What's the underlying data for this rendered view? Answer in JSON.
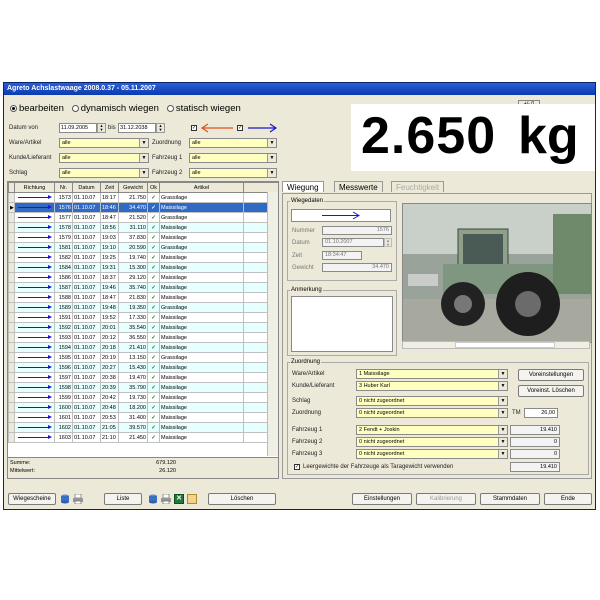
{
  "window": {
    "title": "Agreto Achslastwaage 2008.0.37 - 05.11.2007"
  },
  "modes": [
    {
      "label": "bearbeiten",
      "selected": true
    },
    {
      "label": "dynamisch wiegen",
      "selected": false
    },
    {
      "label": "statisch wiegen",
      "selected": false
    }
  ],
  "filters": {
    "datum_label": "Datum von",
    "date_from": "11.09.2005",
    "bis_label": "bis",
    "date_to": "31.12.2038",
    "ware_label": "Ware/Artikel",
    "ware_value": "alle",
    "zuordnung_label": "Zuordnung",
    "zuordnung_value": "alle",
    "kunde_label": "Kunde/Lieferant",
    "kunde_value": "alle",
    "fahrzeug1_label": "Fahrzeug 1",
    "fahrzeug1_value": "alle",
    "schlag_label": "Schlag",
    "schlag_value": "alle",
    "fahrzeug2_label": "Fahrzeug 2",
    "fahrzeug2_value": "alle"
  },
  "weight": {
    "value": "2.650",
    "unit": "kg",
    "unit_button": "+/- 0"
  },
  "table": {
    "headers": [
      "Richtung",
      "Nr.",
      "Datum",
      "Zeit",
      "Gewicht",
      "Ok",
      "Artikel"
    ],
    "rows": [
      {
        "nr": "1573",
        "datum": "01.10.07",
        "zeit": "18:17",
        "gewicht": "21.750",
        "artikel": "Grassilage"
      },
      {
        "nr": "1576",
        "datum": "01.10.07",
        "zeit": "18:46",
        "gewicht": "34.470",
        "artikel": "Maissilage"
      },
      {
        "nr": "1577",
        "datum": "01.10.07",
        "zeit": "18:47",
        "gewicht": "21.520",
        "artikel": "Grassilage"
      },
      {
        "nr": "1578",
        "datum": "01.10.07",
        "zeit": "18:56",
        "gewicht": "31.110",
        "artikel": "Maissilage"
      },
      {
        "nr": "1579",
        "datum": "01.10.07",
        "zeit": "19:03",
        "gewicht": "37.830",
        "artikel": "Maissilage"
      },
      {
        "nr": "1581",
        "datum": "01.10.07",
        "zeit": "19:10",
        "gewicht": "20.590",
        "artikel": "Grassilage"
      },
      {
        "nr": "1582",
        "datum": "01.10.07",
        "zeit": "19:25",
        "gewicht": "19.740",
        "artikel": "Maissilage"
      },
      {
        "nr": "1584",
        "datum": "01.10.07",
        "zeit": "19:31",
        "gewicht": "15.300",
        "artikel": "Maissilage"
      },
      {
        "nr": "1586",
        "datum": "01.10.07",
        "zeit": "18:37",
        "gewicht": "29.120",
        "artikel": "Maissilage"
      },
      {
        "nr": "1587",
        "datum": "01.10.07",
        "zeit": "19:46",
        "gewicht": "35.740",
        "artikel": "Maissilage"
      },
      {
        "nr": "1588",
        "datum": "01.10.07",
        "zeit": "18:47",
        "gewicht": "21.830",
        "artikel": "Maissilage"
      },
      {
        "nr": "1589",
        "datum": "01.10.07",
        "zeit": "19:48",
        "gewicht": "19.350",
        "artikel": "Grassilage"
      },
      {
        "nr": "1591",
        "datum": "01.10.07",
        "zeit": "19:52",
        "gewicht": "17.330",
        "artikel": "Maissilage"
      },
      {
        "nr": "1592",
        "datum": "01.10.07",
        "zeit": "20:01",
        "gewicht": "35.540",
        "artikel": "Maissilage"
      },
      {
        "nr": "1593",
        "datum": "01.10.07",
        "zeit": "20:12",
        "gewicht": "36.550",
        "artikel": "Maissilage"
      },
      {
        "nr": "1594",
        "datum": "01.10.07",
        "zeit": "20:18",
        "gewicht": "21.410",
        "artikel": "Maissilage"
      },
      {
        "nr": "1595",
        "datum": "01.10.07",
        "zeit": "20:19",
        "gewicht": "13.150",
        "artikel": "Grassilage"
      },
      {
        "nr": "1596",
        "datum": "01.10.07",
        "zeit": "20:27",
        "gewicht": "15.430",
        "artikel": "Maissilage"
      },
      {
        "nr": "1597",
        "datum": "01.10.07",
        "zeit": "20:38",
        "gewicht": "19.470",
        "artikel": "Maissilage"
      },
      {
        "nr": "1598",
        "datum": "01.10.07",
        "zeit": "20:39",
        "gewicht": "35.790",
        "artikel": "Maissilage"
      },
      {
        "nr": "1599",
        "datum": "01.10.07",
        "zeit": "20:42",
        "gewicht": "19.730",
        "artikel": "Maissilage"
      },
      {
        "nr": "1600",
        "datum": "01.10.07",
        "zeit": "20:48",
        "gewicht": "18.200",
        "artikel": "Maissilage"
      },
      {
        "nr": "1601",
        "datum": "01.10.07",
        "zeit": "20:53",
        "gewicht": "31.400",
        "artikel": "Maissilage"
      },
      {
        "nr": "1602",
        "datum": "01.10.07",
        "zeit": "21:05",
        "gewicht": "39.570",
        "artikel": "Maissilage"
      },
      {
        "nr": "1603",
        "datum": "01.10.07",
        "zeit": "21:10",
        "gewicht": "21.450",
        "artikel": "Maissilage"
      }
    ],
    "selected_index": 1,
    "summe_label": "Summe:",
    "mittelwert_label": "Mittelwert:",
    "summe_value": "679.120",
    "mittelwert_value": "26.120"
  },
  "tabs": [
    {
      "label": "Wiegung",
      "active": true
    },
    {
      "label": "Messwerte",
      "active": false
    },
    {
      "label": "Feuchtigkeit",
      "active": false
    }
  ],
  "wiegedaten": {
    "group_label": "Wiegedaten",
    "nummer_label": "Nummer",
    "nummer_value": "1576",
    "datum_label": "Datum",
    "datum_value": "01.10.2007",
    "zeit_label": "Zeit",
    "zeit_value": "18:34:47",
    "gewicht_label": "Gewicht",
    "gewicht_value": "34.470"
  },
  "anmerkung": {
    "label": "Anmerkung"
  },
  "zuordnung": {
    "group_label": "Zuordnung",
    "ware_label": "Ware/Artikel",
    "ware_value": "1 Maissilage",
    "kunde_label": "Kunde/Lieferant",
    "kunde_value": "3 Huber Karl",
    "schlag_label": "Schlag",
    "schlag_value": "0 nicht zugeordnet",
    "zuordnung_label": "Zuordnung",
    "zuordnung_value": "0 nicht zugeordnet",
    "tm_label": "TM",
    "tm_value": "26,00",
    "fahrzeug1_label": "Fahrzeug 1",
    "fahrzeug1_value": "2 Fendt + Joskin",
    "fahrzeug1_weight": "19.410",
    "fahrzeug2_label": "Fahrzeug 2",
    "fahrzeug2_value": "0 nicht zugeordnet",
    "fahrzeug2_weight": "0",
    "fahrzeug3_label": "Fahrzeug 3",
    "fahrzeug3_value": "0 nicht zugeordnet",
    "fahrzeug3_weight": "0",
    "leergewicht_label": "Leergewichte der Fahrzeuge als Taragewicht verwenden",
    "leergewicht_value": "19.410",
    "voreinstellungen_button": "Voreinstellungen",
    "voreinst_loeschen_button": "Voreinst. Löschen"
  },
  "bottom_buttons": {
    "wiegescheine": "Wiegescheine",
    "liste": "Liste",
    "loeschen": "Löschen",
    "einstellungen": "Einstellungen",
    "kalibrierung": "Kalibrierung",
    "stammdaten": "Stammdaten",
    "ende": "Ende"
  },
  "colors": {
    "accent": "#316ac5",
    "arrow": "#1a1acc",
    "combo": "#ffffc0",
    "alt_row": "#e6ffff",
    "title": "#0b3ab0"
  }
}
